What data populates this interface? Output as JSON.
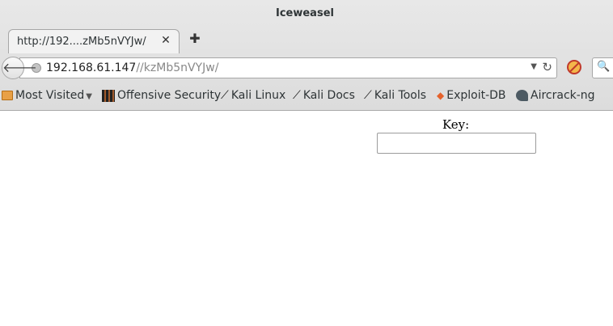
{
  "window": {
    "title": "Iceweasel"
  },
  "tabs": [
    {
      "label": "http://192....zMb5nVYJw/"
    }
  ],
  "navbar": {
    "url_host": "192.168.61.147",
    "url_path": "//kzMb5nVYJw/"
  },
  "bookmarks": [
    {
      "label": "Most Visited",
      "icon": "folder-icon"
    },
    {
      "label": "Offensive Security",
      "icon": "offsec-icon"
    },
    {
      "label": "Kali Linux",
      "icon": "kali-dragon-icon"
    },
    {
      "label": "Kali Docs",
      "icon": "kali-dragon-icon"
    },
    {
      "label": "Kali Tools",
      "icon": "kali-dragon-icon"
    },
    {
      "label": "Exploit-DB",
      "icon": "exploit-db-icon"
    },
    {
      "label": "Aircrack-ng",
      "icon": "aircrack-icon"
    }
  ],
  "page": {
    "key_label": "Key:",
    "key_value": ""
  }
}
